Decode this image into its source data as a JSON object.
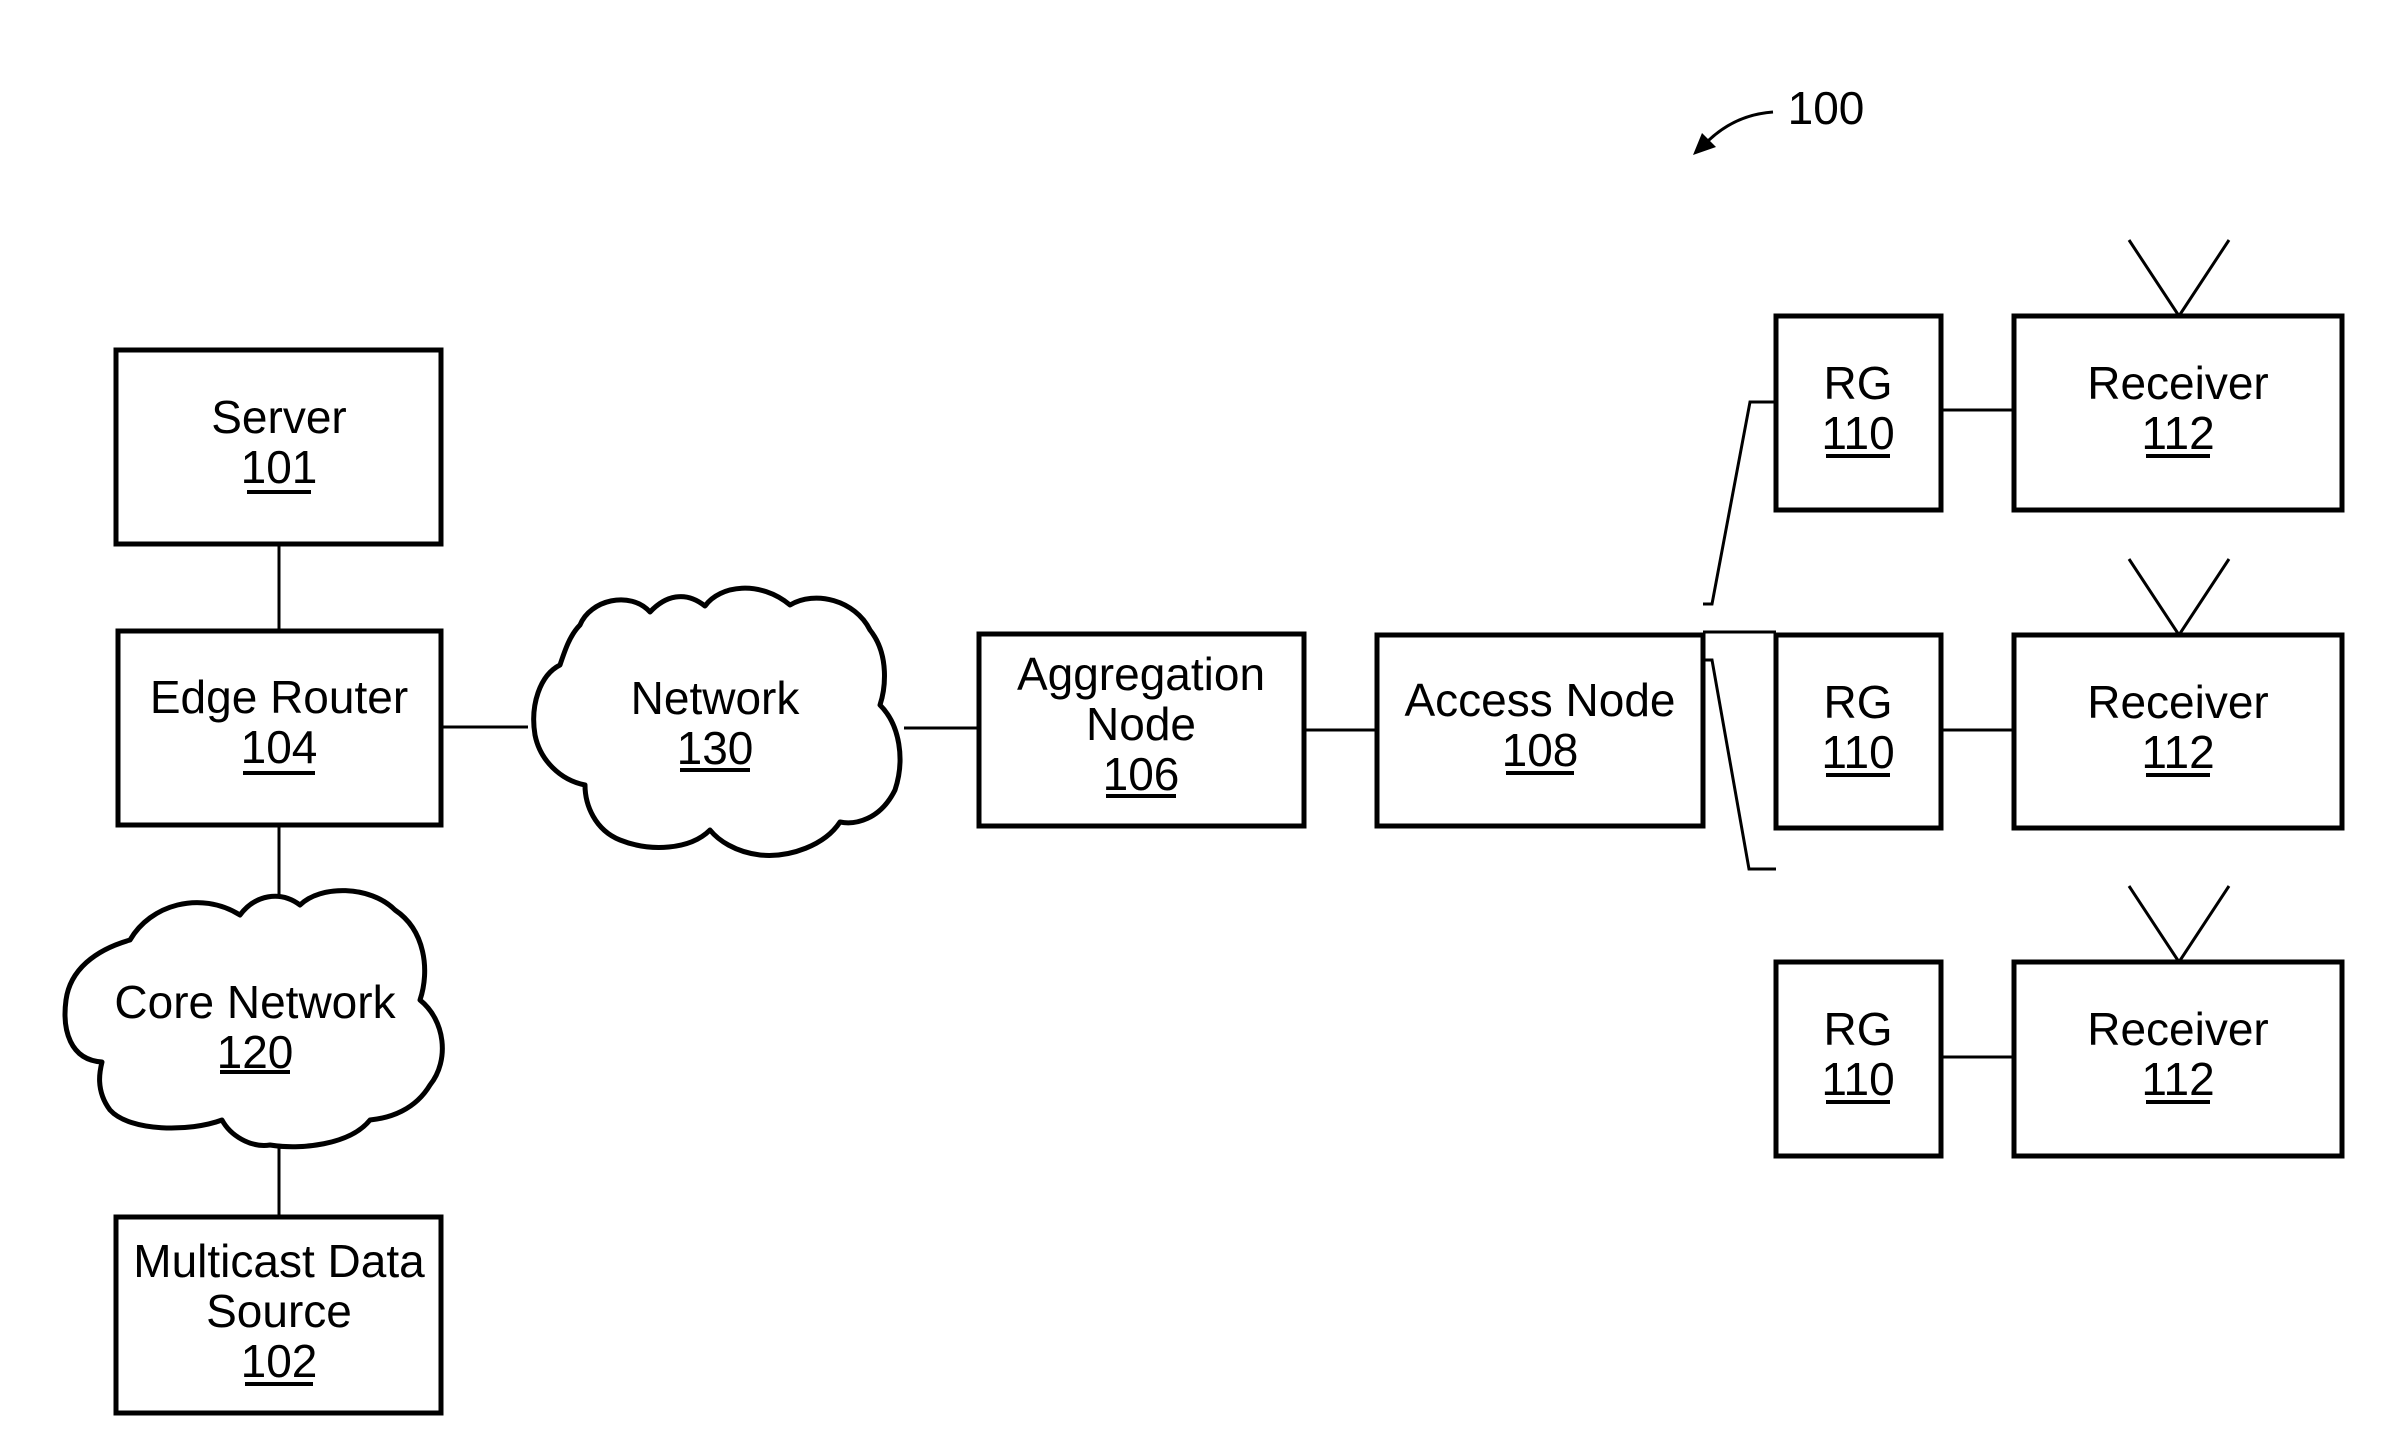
{
  "figure": {
    "reference_label": "100",
    "nodes": [
      {
        "id": "server",
        "label_lines": [
          "Server"
        ],
        "ref": "101",
        "shape": "box"
      },
      {
        "id": "edge-router",
        "label_lines": [
          "Edge Router"
        ],
        "ref": "104",
        "shape": "box"
      },
      {
        "id": "core-network",
        "label_lines": [
          "Core Network"
        ],
        "ref": "120",
        "shape": "cloud"
      },
      {
        "id": "multicast-data-source",
        "label_lines": [
          "Multicast Data",
          "Source"
        ],
        "ref": "102",
        "shape": "box"
      },
      {
        "id": "network",
        "label_lines": [
          "Network"
        ],
        "ref": "130",
        "shape": "cloud"
      },
      {
        "id": "aggregation-node",
        "label_lines": [
          "Aggregation",
          "Node"
        ],
        "ref": "106",
        "shape": "box"
      },
      {
        "id": "access-node",
        "label_lines": [
          "Access Node"
        ],
        "ref": "108",
        "shape": "box"
      },
      {
        "id": "rg-1",
        "label_lines": [
          "RG"
        ],
        "ref": "110",
        "shape": "box"
      },
      {
        "id": "receiver-1",
        "label_lines": [
          "Receiver"
        ],
        "ref": "112",
        "shape": "box",
        "antenna": true
      },
      {
        "id": "rg-2",
        "label_lines": [
          "RG"
        ],
        "ref": "110",
        "shape": "box"
      },
      {
        "id": "receiver-2",
        "label_lines": [
          "Receiver"
        ],
        "ref": "112",
        "shape": "box",
        "antenna": true
      },
      {
        "id": "rg-3",
        "label_lines": [
          "RG"
        ],
        "ref": "110",
        "shape": "box"
      },
      {
        "id": "receiver-3",
        "label_lines": [
          "Receiver"
        ],
        "ref": "112",
        "shape": "box",
        "antenna": true
      }
    ],
    "edges": [
      [
        "server",
        "edge-router"
      ],
      [
        "edge-router",
        "core-network"
      ],
      [
        "core-network",
        "multicast-data-source"
      ],
      [
        "edge-router",
        "network"
      ],
      [
        "network",
        "aggregation-node"
      ],
      [
        "aggregation-node",
        "access-node"
      ],
      [
        "access-node",
        "rg-1"
      ],
      [
        "access-node",
        "rg-2"
      ],
      [
        "access-node",
        "rg-3"
      ],
      [
        "rg-1",
        "receiver-1"
      ],
      [
        "rg-2",
        "receiver-2"
      ],
      [
        "rg-3",
        "receiver-3"
      ]
    ]
  }
}
